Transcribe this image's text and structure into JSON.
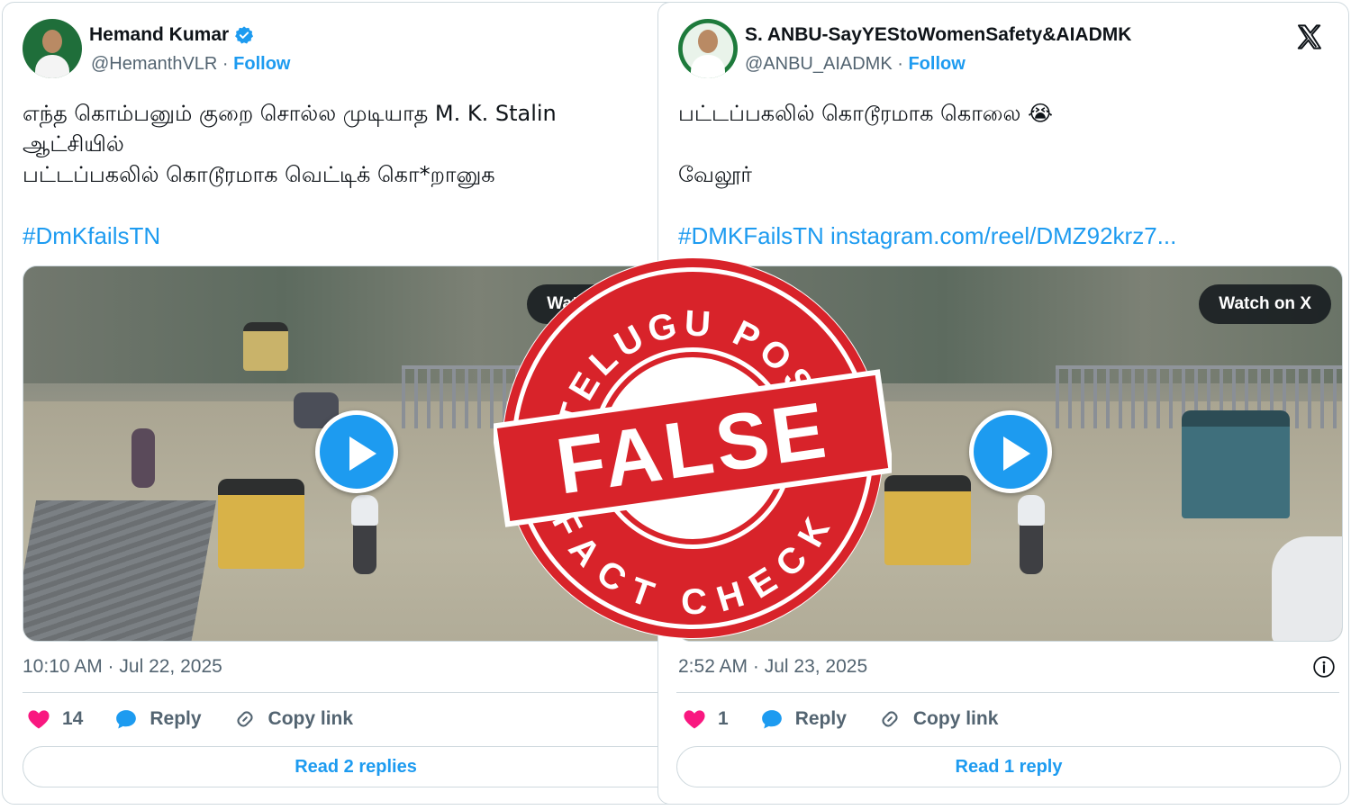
{
  "left_tweet": {
    "display_name": "Hemand Kumar",
    "handle_line": "@HemanthVLR · ",
    "follow": "Follow",
    "text": "எந்த கொம்பனும் குறை சொல்ல முடியாத M. K. Stalin\nஆட்சியில்\nபட்டப்பகலில் கொடூரமாக வெட்டிக் கொ*றானுக",
    "hashtag": "#DmKfailsTN",
    "timestamp": "10:10 AM · Jul 22, 2025",
    "likes": "14",
    "reply_label": "Reply",
    "copy_label": "Copy link",
    "read_replies": "Read 2 replies",
    "watch_label": "Watch on X"
  },
  "right_tweet": {
    "display_name": "S. ANBU-SayYEStoWomenSafety&AIADMK",
    "handle_line": "@ANBU_AIADMK · ",
    "follow": "Follow",
    "text": "பட்டப்பகலில் கொடூரமாக கொலை 😭\n\n வேலூர்",
    "hashtag": "#DMKFailsTN instagram.com/reel/DMZ92krz7...",
    "timestamp": "2:52 AM · Jul 23, 2025",
    "likes": "1",
    "reply_label": "Reply",
    "copy_label": "Copy link",
    "read_replies": "Read 1 reply",
    "watch_label": "Watch on X"
  },
  "stamp": {
    "top_text": "TELUGU POST",
    "verdict": "FALSE",
    "bottom_text": "FACT CHECK",
    "color": "#d8232a"
  },
  "colors": {
    "link": "#1d9bf0",
    "like": "#f91880",
    "muted": "#536471"
  }
}
